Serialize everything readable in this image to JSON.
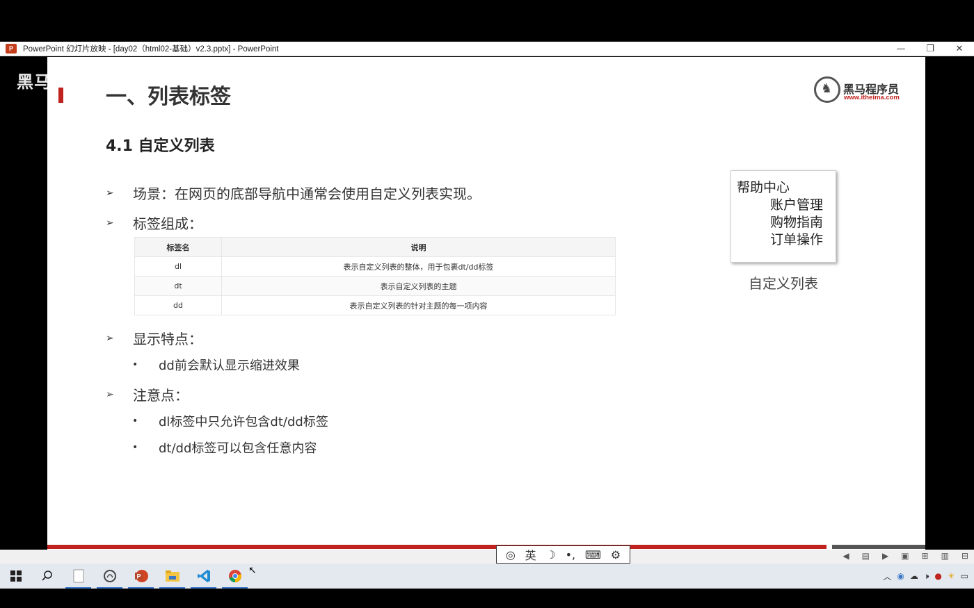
{
  "titlebar": {
    "app_icon": "P",
    "title": "PowerPoint 幻灯片放映 - [day02（html02-基础）v2.3.pptx] - PowerPoint",
    "minimize": "—",
    "restore": "❐",
    "close": "✕"
  },
  "watermark": "黑马",
  "slide": {
    "title": "一、列表标签",
    "logo": {
      "name": "黑马程序员",
      "url": "www.itheima.com"
    },
    "subtitle": "4.1 自定义列表",
    "bullets": {
      "scene": "场景：在网页的底部导航中通常会使用自定义列表实现。",
      "composition": "标签组成：",
      "display": "显示特点：",
      "display_item": "dd前会默认显示缩进效果",
      "notes": "注意点：",
      "note_1": "dl标签中只允许包含dt/dd标签",
      "note_2": "dt/dd标签可以包含任意内容"
    },
    "table": {
      "headers": [
        "标签名",
        "说明"
      ],
      "rows": [
        [
          "dl",
          "表示自定义列表的整体，用于包裹dt/dd标签"
        ],
        [
          "dt",
          "表示自定义列表的主题"
        ],
        [
          "dd",
          "表示自定义列表的针对主题的每一项内容"
        ]
      ]
    },
    "example": {
      "dt": "帮助中心",
      "dd": [
        "账户管理",
        "购物指南",
        "订单操作"
      ],
      "caption": "自定义列表"
    }
  },
  "ime": [
    "英",
    "☽",
    "•,",
    "⌨",
    "⚙"
  ],
  "status_icons": [
    "◀",
    "▤",
    "▶",
    "▣",
    "⊞",
    "▥",
    "⊟"
  ],
  "taskbar": {
    "start": "start-icon",
    "search": "search-icon",
    "apps": [
      "file-icon",
      "circle-app-icon",
      "powerpoint-icon",
      "file-explorer-icon",
      "vscode-icon",
      "chrome-icon"
    ]
  },
  "colors": {
    "accent_red": "#c0231f",
    "taskbar": "#e4e9f0"
  }
}
